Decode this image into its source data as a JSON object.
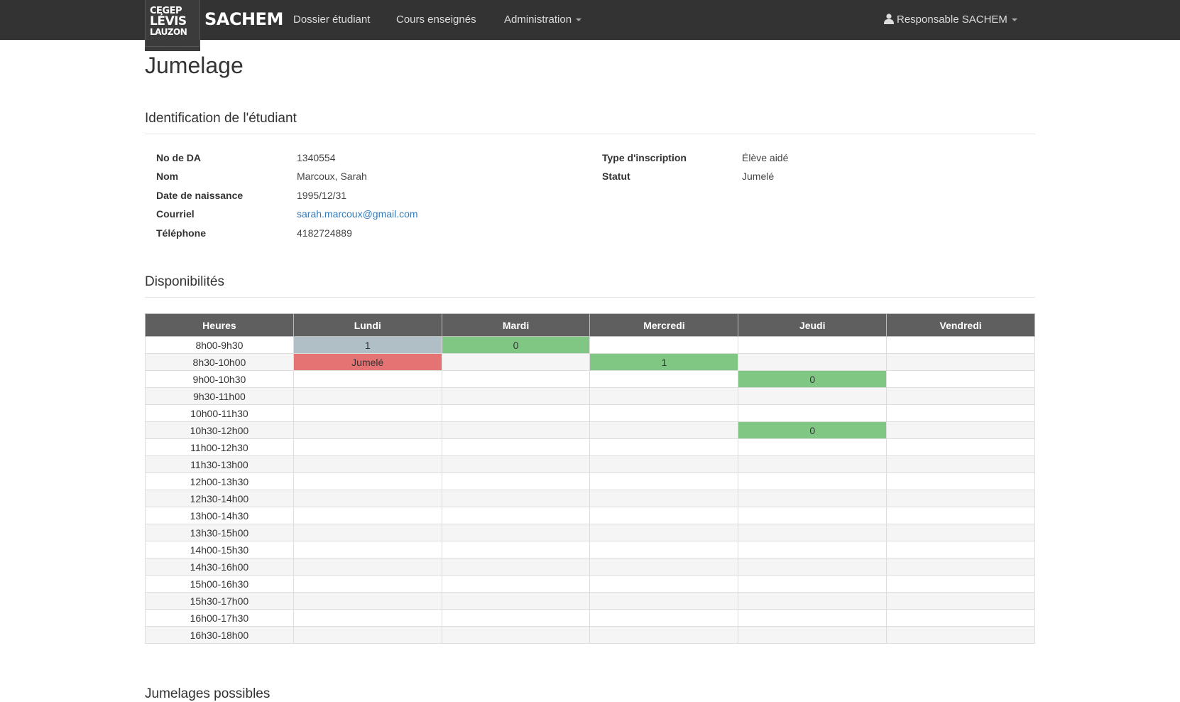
{
  "navbar": {
    "logo_line1": "CEGEP",
    "logo_line2": "LÉVIS",
    "logo_line3": "LAUZON",
    "brand": "SACHEM",
    "links": [
      "Dossier étudiant",
      "Cours enseignés",
      "Administration"
    ],
    "user": "Responsable SACHEM"
  },
  "page": {
    "title": "Jumelage"
  },
  "identification": {
    "heading": "Identification de l'étudiant",
    "left": [
      {
        "label": "No de DA",
        "value": "1340554"
      },
      {
        "label": "Nom",
        "value": "Marcoux, Sarah"
      },
      {
        "label": "Date de naissance",
        "value": "1995/12/31"
      },
      {
        "label": "Courriel",
        "value": "sarah.marcoux@gmail.com"
      },
      {
        "label": "Téléphone",
        "value": "4182724889"
      }
    ],
    "right": [
      {
        "label": "Type d'inscription",
        "value": "Élève aidé"
      },
      {
        "label": "Statut",
        "value": "Jumelé"
      }
    ]
  },
  "availability": {
    "heading": "Disponibilités",
    "columns": [
      "Heures",
      "Lundi",
      "Mardi",
      "Mercredi",
      "Jeudi",
      "Vendredi"
    ],
    "rows": [
      {
        "time": "8h00-9h30",
        "cells": [
          "1",
          "0",
          "",
          "",
          ""
        ]
      },
      {
        "time": "8h30-10h00",
        "cells": [
          "Jumelé",
          "",
          "1",
          "",
          ""
        ]
      },
      {
        "time": "9h00-10h30",
        "cells": [
          "",
          "",
          "",
          "0",
          ""
        ]
      },
      {
        "time": "9h30-11h00",
        "cells": [
          "",
          "",
          "",
          "",
          ""
        ]
      },
      {
        "time": "10h00-11h30",
        "cells": [
          "",
          "",
          "",
          "",
          ""
        ]
      },
      {
        "time": "10h30-12h00",
        "cells": [
          "",
          "",
          "",
          "0",
          ""
        ]
      },
      {
        "time": "11h00-12h30",
        "cells": [
          "",
          "",
          "",
          "",
          ""
        ]
      },
      {
        "time": "11h30-13h00",
        "cells": [
          "",
          "",
          "",
          "",
          ""
        ]
      },
      {
        "time": "12h00-13h30",
        "cells": [
          "",
          "",
          "",
          "",
          ""
        ]
      },
      {
        "time": "12h30-14h00",
        "cells": [
          "",
          "",
          "",
          "",
          ""
        ]
      },
      {
        "time": "13h00-14h30",
        "cells": [
          "",
          "",
          "",
          "",
          ""
        ]
      },
      {
        "time": "13h30-15h00",
        "cells": [
          "",
          "",
          "",
          "",
          ""
        ]
      },
      {
        "time": "14h00-15h30",
        "cells": [
          "",
          "",
          "",
          "",
          ""
        ]
      },
      {
        "time": "14h30-16h00",
        "cells": [
          "",
          "",
          "",
          "",
          ""
        ]
      },
      {
        "time": "15h00-16h30",
        "cells": [
          "",
          "",
          "",
          "",
          ""
        ]
      },
      {
        "time": "15h30-17h00",
        "cells": [
          "",
          "",
          "",
          "",
          ""
        ]
      },
      {
        "time": "16h00-17h30",
        "cells": [
          "",
          "",
          "",
          "",
          ""
        ]
      },
      {
        "time": "16h30-18h00",
        "cells": [
          "",
          "",
          "",
          "",
          ""
        ]
      }
    ],
    "highlights": [
      {
        "row": 0,
        "col": 0,
        "color": "#b0bec5"
      },
      {
        "row": 0,
        "col": 1,
        "color": "#81c784"
      },
      {
        "row": 1,
        "col": 0,
        "color": "#e57373"
      },
      {
        "row": 1,
        "col": 2,
        "color": "#81c784"
      },
      {
        "row": 2,
        "col": 3,
        "color": "#81c784"
      },
      {
        "row": 5,
        "col": 3,
        "color": "#81c784"
      }
    ]
  },
  "next_section": {
    "heading": "Jumelages possibles"
  }
}
